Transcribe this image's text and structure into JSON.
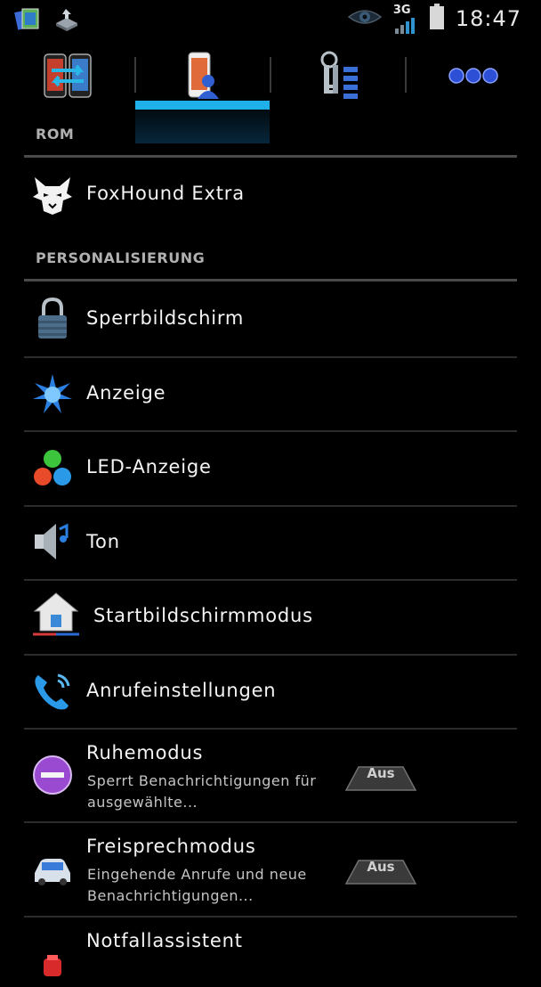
{
  "status_bar": {
    "time": "18:47",
    "network": "3G",
    "icons": [
      "screenshot-gallery-icon",
      "usb-debug-icon",
      "eye-icon",
      "signal-icon",
      "battery-icon"
    ]
  },
  "tabs": [
    {
      "name": "tab-rom",
      "icon": "phone-swap-icon"
    },
    {
      "name": "tab-personal",
      "icon": "phone-user-icon",
      "selected": true
    },
    {
      "name": "tab-security",
      "icon": "keys-list-icon"
    },
    {
      "name": "tab-more",
      "icon": "more-dots-icon"
    }
  ],
  "accent": "#1fb0ea",
  "sections": {
    "rom": "ROM",
    "personal": "PERSONALISIERUNG"
  },
  "items": {
    "foxhound": {
      "title": "FoxHound Extra",
      "icon": "bobcat-logo-icon"
    },
    "lockscreen": {
      "title": "Sperrbildschirm",
      "icon": "padlock-icon"
    },
    "display": {
      "title": "Anzeige",
      "icon": "display-burst-icon"
    },
    "led": {
      "title": "LED-Anzeige",
      "icon": "led-dots-icon"
    },
    "sound": {
      "title": "Ton",
      "icon": "speaker-icon"
    },
    "homescreen": {
      "title": "Startbildschirmmodus",
      "icon": "home-icon"
    },
    "calls": {
      "title": "Anrufeinstellungen",
      "icon": "phone-call-icon"
    },
    "blocking": {
      "title": "Ruhemodus",
      "summary": "Sperrt Benachrichtigungen für ausgewählte...",
      "toggle": "Aus",
      "icon": "minus-circle-icon"
    },
    "driving": {
      "title": "Freisprechmodus",
      "summary": "Eingehende Anrufe und neue Benachrichtigungen...",
      "toggle": "Aus",
      "icon": "car-icon"
    },
    "emergency": {
      "title": "Notfallassistent",
      "icon": "emergency-icon"
    }
  }
}
